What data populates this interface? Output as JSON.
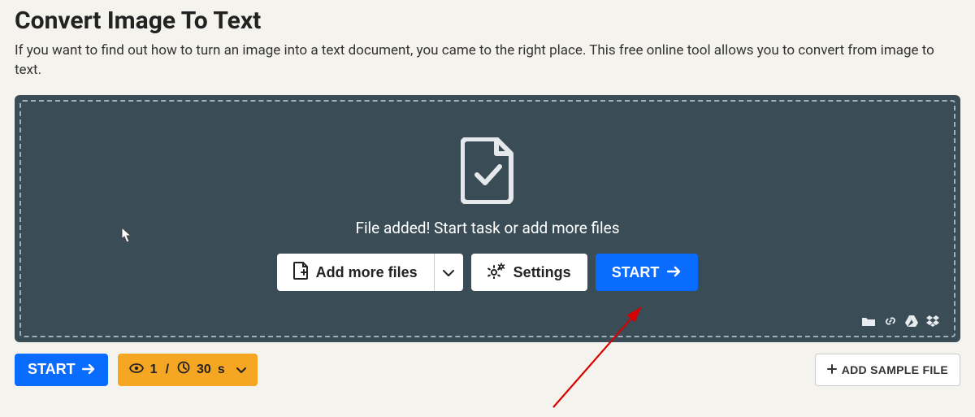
{
  "header": {
    "title": "Convert Image To Text",
    "subtitle": "If you want to find out how to turn an image into a text document, you came to the right place. This free online tool allows you to convert from image to text."
  },
  "dropzone": {
    "message": "File added! Start task or add more files",
    "add_more_label": "Add more files",
    "settings_label": "Settings",
    "start_label": "START"
  },
  "bottom": {
    "start_label": "START",
    "file_count": "1",
    "separator": "/",
    "duration_value": "30",
    "duration_unit": "s",
    "add_sample_label": "ADD SAMPLE FILE"
  },
  "colors": {
    "primary": "#0a6bff",
    "accent": "#f5a623",
    "panel": "#3a4d57",
    "bg": "#f5f3ee",
    "annotation": "#d90000"
  }
}
